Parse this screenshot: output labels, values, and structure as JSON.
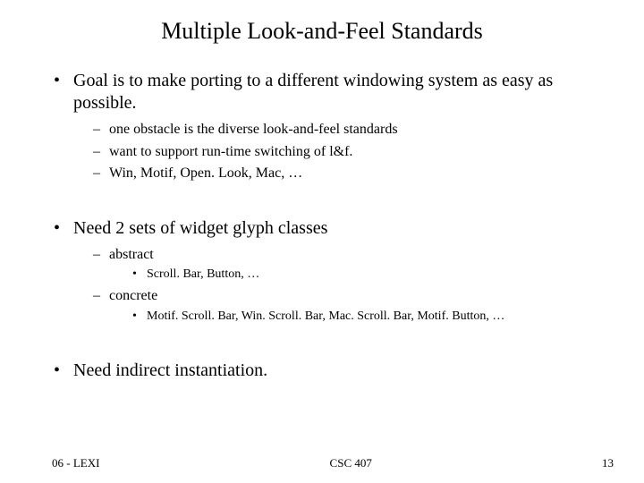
{
  "title": "Multiple Look-and-Feel Standards",
  "bullets": [
    {
      "text": "Goal is to make porting to a different windowing system as easy as possible.",
      "sub": [
        {
          "text": "one obstacle is the diverse look-and-feel standards"
        },
        {
          "text": "want to support run-time switching of l&f."
        },
        {
          "text": "Win, Motif, Open. Look, Mac, …"
        }
      ]
    },
    {
      "text": "Need 2 sets of widget glyph classes",
      "sub": [
        {
          "text": "abstract",
          "sub": [
            {
              "text": "Scroll. Bar, Button, …"
            }
          ]
        },
        {
          "text": "concrete",
          "sub": [
            {
              "text": "Motif. Scroll. Bar, Win. Scroll. Bar, Mac. Scroll. Bar, Motif. Button, …"
            }
          ]
        }
      ]
    },
    {
      "text": "Need indirect instantiation."
    }
  ],
  "footer": {
    "left": "06 - LEXI",
    "center": "CSC 407",
    "right": "13"
  }
}
